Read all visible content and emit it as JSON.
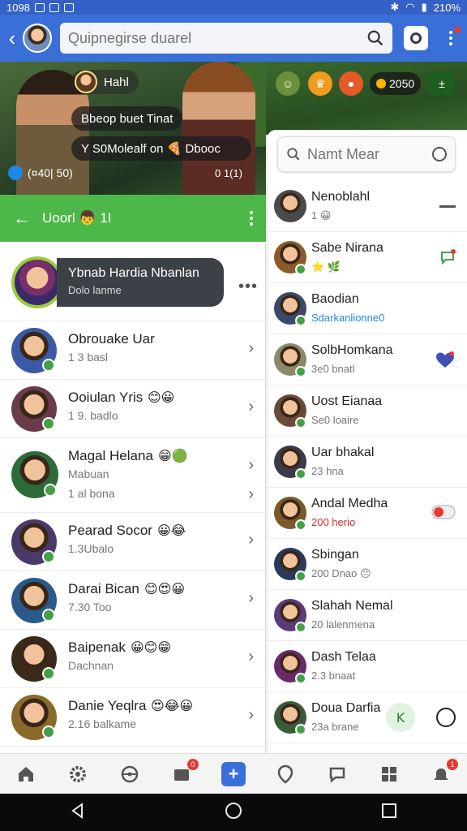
{
  "status_bar": {
    "time": "1098",
    "battery": "210%"
  },
  "topbar": {
    "search_placeholder": "Quipnegirse duarel"
  },
  "hero": {
    "player_name": "Hahl",
    "event_text": "Bbeop buet Tinat",
    "offer_text": "Y  S0Molealf on 🍕 Dbooc",
    "status_left": "(¤40| 50)",
    "status_right": "0 1(1)"
  },
  "green_bar": {
    "title": "Uoorl 👦 1I"
  },
  "featured_contact": {
    "name": "Ybnab Hardia Nbanlan",
    "sub": "Dolo lanme"
  },
  "left_contacts": [
    {
      "name": "Obrouake Uar",
      "sub": "1 3 basl",
      "sub2": "",
      "emoji": "",
      "color": "#3a5aa8"
    },
    {
      "name": "Ooiulan Yris",
      "sub": "1 9. badlo",
      "sub2": "",
      "emoji": "😊😀",
      "color": "#6a3b4a"
    },
    {
      "name": "Magal Helana",
      "sub": "Mabuan",
      "sub2": "1 al bona",
      "emoji": "😁🟢",
      "color": "#2d6a3a"
    },
    {
      "name": "Pearad Socor",
      "sub": "1.3Ubalo",
      "sub2": "",
      "emoji": "😀😂",
      "color": "#4a3a6a"
    },
    {
      "name": "Darai Bican",
      "sub": "7.30 Too",
      "sub2": "",
      "emoji": "😊😍😀",
      "color": "#2a5a8a"
    },
    {
      "name": "Baipenak",
      "sub": "Dachnan",
      "sub2": "",
      "emoji": "😀😊😁",
      "color": "#3a2a1a"
    },
    {
      "name": "Danie Yeqlra",
      "sub": "2.16 balkame",
      "sub2": "",
      "emoji": "😍😂😀",
      "color": "#8a6a2a"
    }
  ],
  "right_top": {
    "coins": "2050"
  },
  "right_search": {
    "placeholder": "Namt Mear"
  },
  "right_contacts": [
    {
      "name": "Nenoblahl",
      "sub": "1 😀",
      "sub_style": "",
      "color": "#4a4a4a"
    },
    {
      "name": "Sabe Nirana",
      "sub": "⭐ 🌿",
      "sub_style": "",
      "color": "#8a5a2a"
    },
    {
      "name": "Baodian",
      "sub": "Sdarkanlionne0",
      "sub_style": "blue",
      "color": "#3a4a6a"
    },
    {
      "name": "SolbHomkana",
      "sub": "3e0 bnatl",
      "sub_style": "",
      "color": "#8a8a6a"
    },
    {
      "name": "Uost Eianaa",
      "sub": "Se0 loaire",
      "sub_style": "",
      "color": "#6a4a3a"
    },
    {
      "name": "Uar bhakal",
      "sub": "23 hna",
      "sub_style": "",
      "color": "#3a3a4a"
    },
    {
      "name": "Andal Medha",
      "sub": "200 herio",
      "sub_style": "red",
      "color": "#7a5a2a"
    },
    {
      "name": "Sbingan",
      "sub": "200 Dnao 😐",
      "sub_style": "",
      "color": "#2a3a5a"
    },
    {
      "name": "Slahah Nemal",
      "sub": "20 lalenmena",
      "sub_style": "",
      "color": "#5a3a7a"
    },
    {
      "name": "Dash Telaa",
      "sub": "2.3 bnaat",
      "sub_style": "",
      "color": "#6a2a6a"
    },
    {
      "name": "Doua Darfia",
      "sub": "23a brane",
      "sub_style": "",
      "color": "#3a5a3a"
    }
  ],
  "bottom_nav": {
    "badge_games": "0",
    "badge_alerts": "1"
  },
  "colors": {
    "primary": "#3b6fd8",
    "green": "#4cb84a",
    "dark_pill": "#3c4148"
  }
}
